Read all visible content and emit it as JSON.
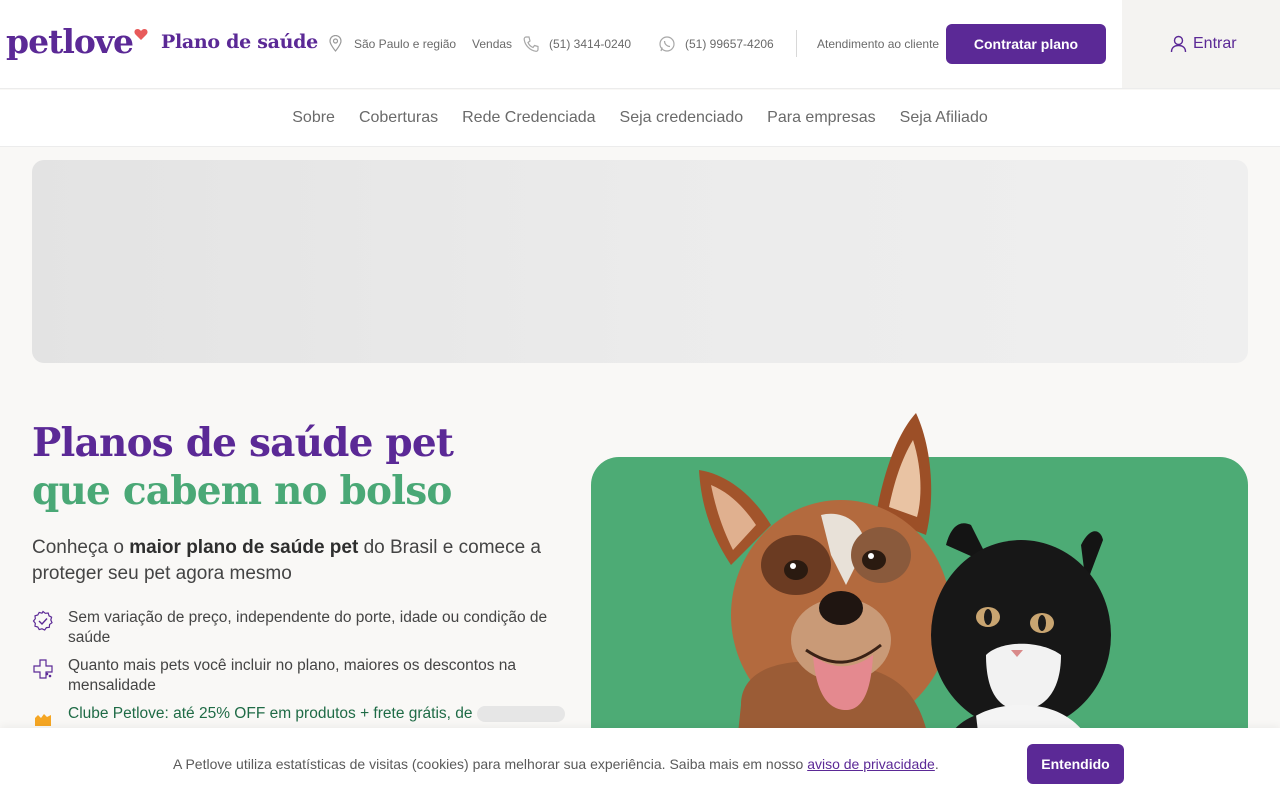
{
  "header": {
    "logo_text": "petlove",
    "product_title": "Plano de saúde",
    "location": "São Paulo e região",
    "sales_label": "Vendas",
    "phone_sales": "(51) 3414-0240",
    "phone_whatsapp": "(51) 99657-4206",
    "customer_service": "Atendimento ao cliente",
    "cta_label": "Contratar plano",
    "login_label": "Entrar"
  },
  "nav": {
    "items": [
      {
        "label": "Sobre"
      },
      {
        "label": "Coberturas"
      },
      {
        "label": "Rede Credenciada"
      },
      {
        "label": "Seja credenciado"
      },
      {
        "label": "Para empresas"
      },
      {
        "label": "Seja Afiliado"
      }
    ]
  },
  "hero": {
    "title_line1": "Planos de saúde pet",
    "title_line2": "que cabem no bolso",
    "subtitle_pre": "Conheça o ",
    "subtitle_bold": "maior plano de saúde pet",
    "subtitle_post": " do Brasil e comece a proteger seu pet agora mesmo",
    "features": [
      {
        "icon": "badge-check-icon",
        "text": "Sem variação de preço, independente do porte, idade ou condição de saúde"
      },
      {
        "icon": "paw-plus-icon",
        "text": "Quanto mais pets você incluir no plano, maiores os descontos na mensalidade"
      },
      {
        "icon": "club-icon",
        "text": "Clube Petlove: até 25% OFF em produtos + frete grátis, de"
      }
    ]
  },
  "cookie": {
    "text": "A Petlove utiliza estatísticas de visitas (cookies) para melhorar sua experiência. Saiba mais em nosso",
    "link_text": "aviso de privacidade",
    "suffix": ".",
    "button_label": "Entendido"
  },
  "colors": {
    "brand_purple": "#5b2996",
    "brand_green": "#4aa876",
    "heart_red": "#e85a5a"
  }
}
